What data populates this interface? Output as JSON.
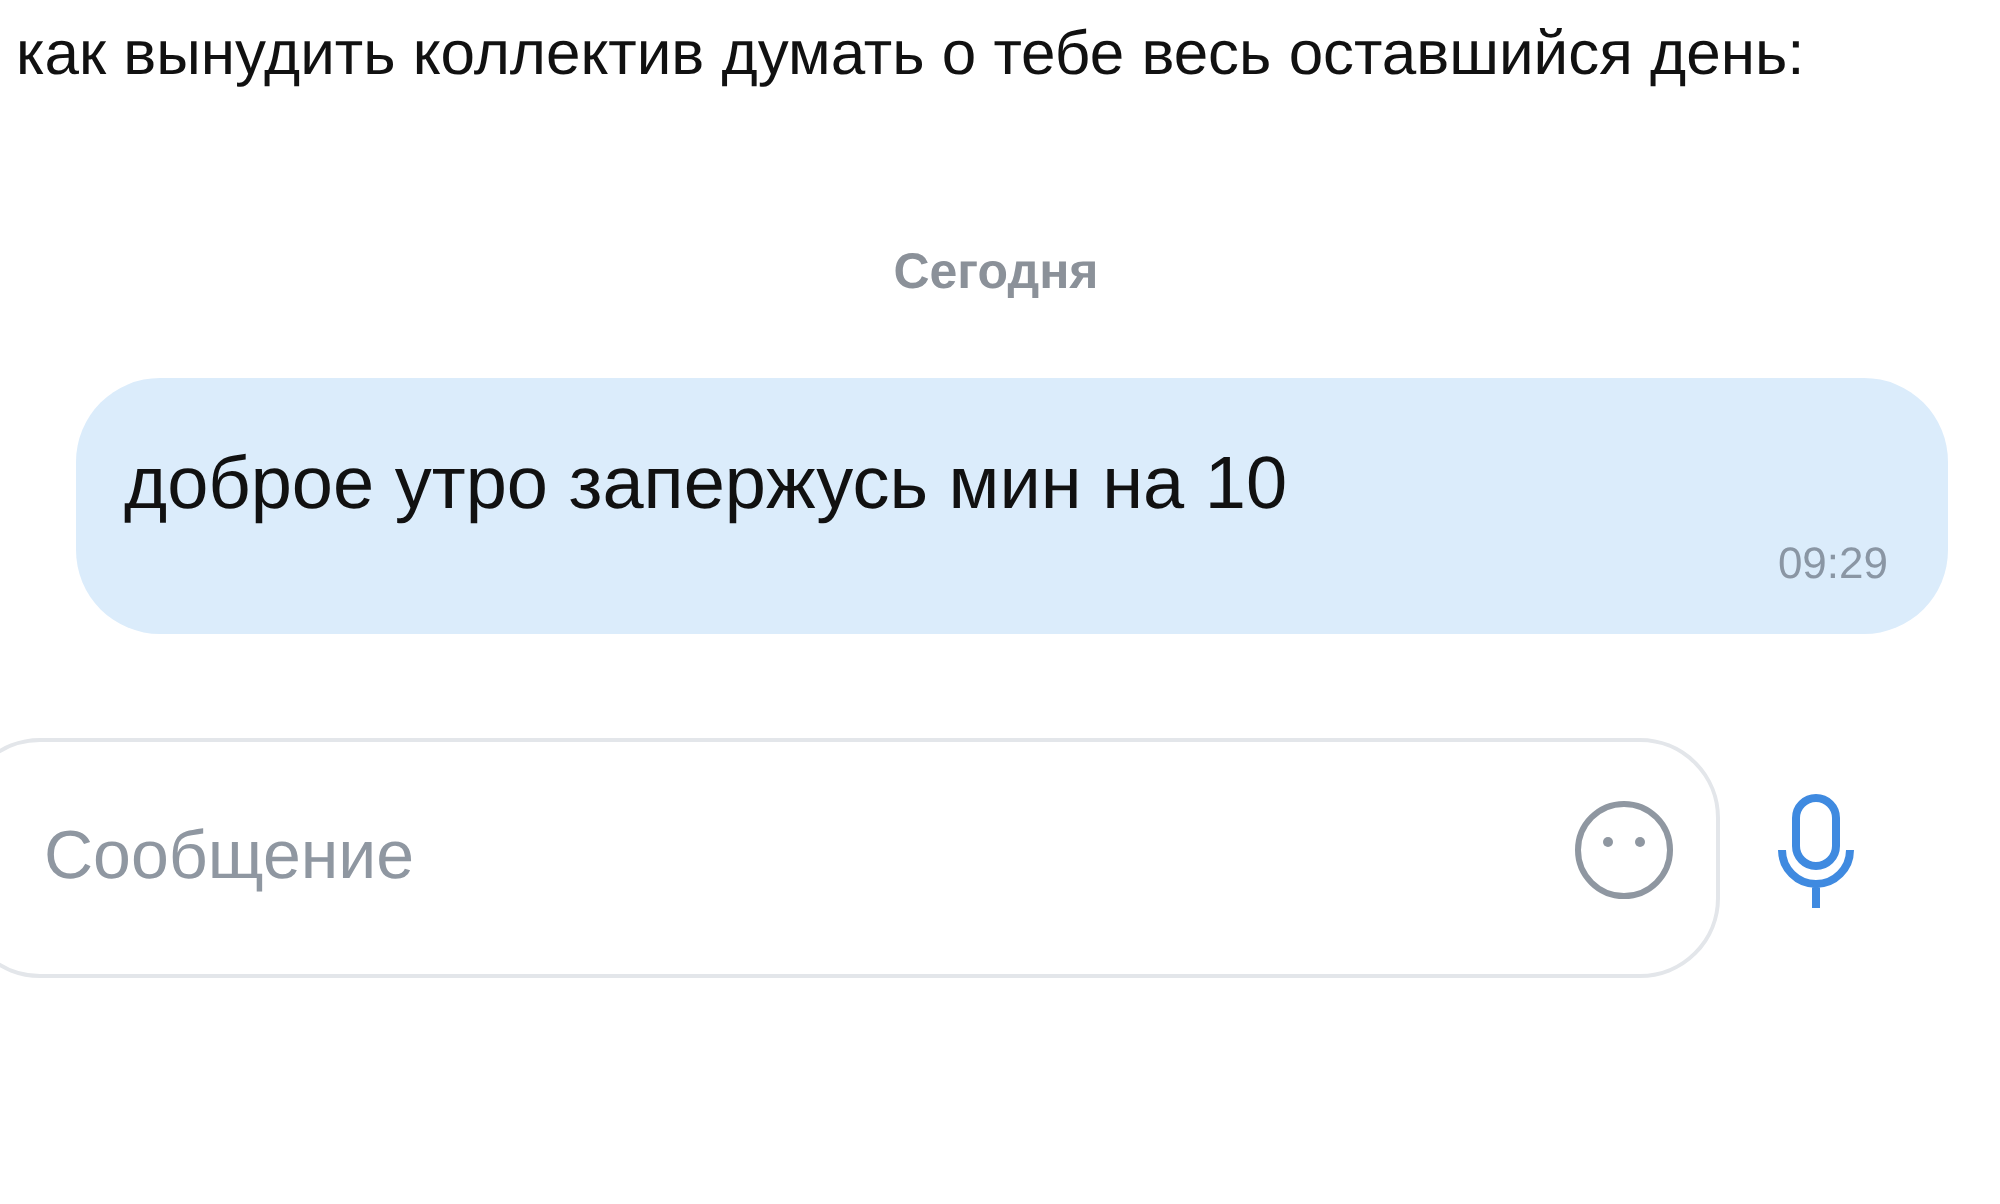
{
  "caption": "как вынудить коллектив думать о тебе весь оставшийся день:",
  "chat": {
    "date_divider": "Сегодня",
    "messages": [
      {
        "text": "доброе утро запержусь мин на 10",
        "time": "09:29"
      }
    ]
  },
  "composer": {
    "placeholder": "Сообщение"
  }
}
